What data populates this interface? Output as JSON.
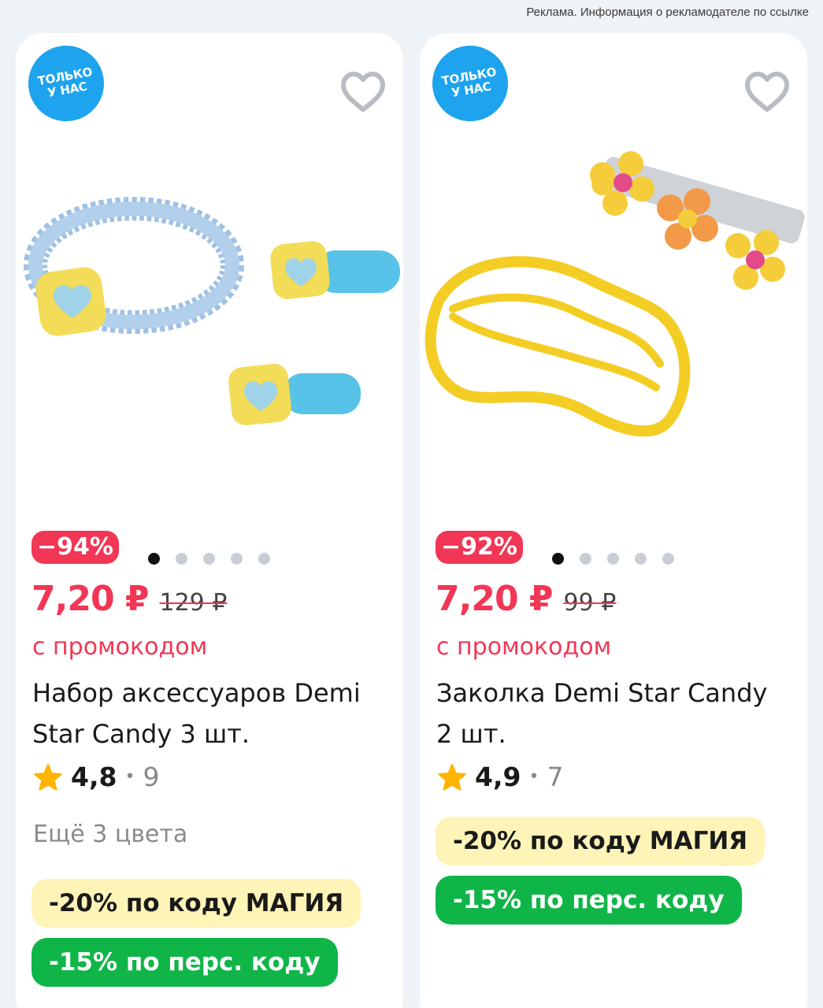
{
  "ad_notice": "Реклама. Информация о рекламодателе по ссылке",
  "products": [
    {
      "badge": "ТОЛЬКО\nУ НАС",
      "discount": "−94%",
      "price": "7,20 ₽",
      "old_price": "129 ₽",
      "promo_label": "с промокодом",
      "title": "Набор аксессуаров Demi Star Candy 3 шт.",
      "rating": "4,8",
      "separator": "•",
      "reviews": "9",
      "more_colors": "Ещё 3 цвета",
      "chip_code": "-20% по коду МАГИЯ",
      "chip_personal": "-15% по перс. коду",
      "image_dots": 5,
      "active_dot": 0
    },
    {
      "badge": "ТОЛЬКО\nУ НАС",
      "discount": "−92%",
      "price": "7,20 ₽",
      "old_price": "99 ₽",
      "promo_label": "с промокодом",
      "title": "Заколка Demi Star Candy 2 шт.",
      "rating": "4,9",
      "separator": "•",
      "reviews": "7",
      "chip_code": "-20% по коду МАГИЯ",
      "chip_personal": "-15% по перс. коду",
      "image_dots": 5,
      "active_dot": 0
    }
  ],
  "colors": {
    "accent_red": "#f23655",
    "badge_blue": "#1ea3ee",
    "chip_yellow": "#fff4b8",
    "chip_green": "#10b548",
    "star": "#ffb400"
  },
  "icons": {
    "favorite": "heart-outline-icon",
    "rating": "star-icon"
  }
}
